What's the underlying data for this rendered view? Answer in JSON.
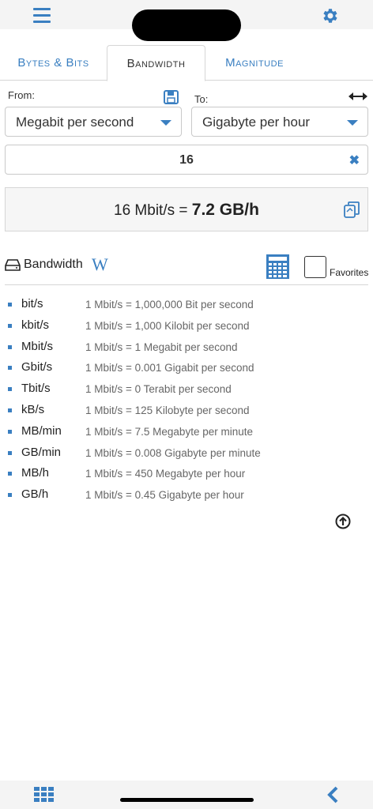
{
  "tabs": [
    {
      "label": "Bytes & Bits"
    },
    {
      "label": "Bandwidth"
    },
    {
      "label": "Magnitude"
    }
  ],
  "active_tab": "Bandwidth",
  "from_label": "From:",
  "to_label": "To:",
  "from_unit": "Megabit per second",
  "to_unit": "Gigabyte per hour",
  "input_value": "16",
  "result": {
    "left": "16 Mbit/s = ",
    "right": "7.2 GB/h"
  },
  "category_title": "Bandwidth",
  "wiki_glyph": "W",
  "favorites_label": "Favorites",
  "favorites_checked": false,
  "conversions": [
    {
      "unit": "bit/s",
      "desc": "1 Mbit/s = 1,000,000 Bit per second"
    },
    {
      "unit": "kbit/s",
      "desc": "1 Mbit/s = 1,000 Kilobit per second"
    },
    {
      "unit": "Mbit/s",
      "desc": "1 Mbit/s = 1 Megabit per second"
    },
    {
      "unit": "Gbit/s",
      "desc": "1 Mbit/s = 0.001 Gigabit per second"
    },
    {
      "unit": "Tbit/s",
      "desc": "1 Mbit/s = 0 Terabit per second"
    },
    {
      "unit": "kB/s",
      "desc": "1 Mbit/s = 125 Kilobyte per second"
    },
    {
      "unit": "MB/min",
      "desc": "1 Mbit/s = 7.5 Megabyte per minute"
    },
    {
      "unit": "GB/min",
      "desc": "1 Mbit/s = 0.008 Gigabyte per minute"
    },
    {
      "unit": "MB/h",
      "desc": "1 Mbit/s = 450 Megabyte per hour"
    },
    {
      "unit": "GB/h",
      "desc": "1 Mbit/s = 0.45 Gigabyte per hour"
    }
  ],
  "colors": {
    "accent": "#3a7fc1",
    "bar_bg": "#f4f4f4",
    "result_bg": "#f6f6f6"
  },
  "icons": [
    "menu-icon",
    "gear-icon",
    "save-icon",
    "swap-icon",
    "chevron-down-icon",
    "clear-icon",
    "copy-icon",
    "drive-icon",
    "wikipedia-icon",
    "calculator-icon",
    "arrow-up-circle-icon",
    "grid-icon",
    "back-icon"
  ]
}
